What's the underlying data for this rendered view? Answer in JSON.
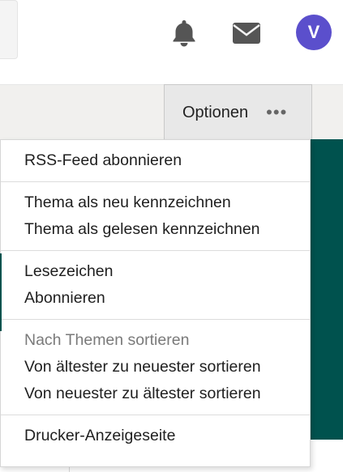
{
  "header": {
    "avatar_initial": "V",
    "bell_icon": "bell-icon",
    "mail_icon": "envelope-icon"
  },
  "toolbar": {
    "options_label": "Optionen",
    "more_icon": "•••"
  },
  "menu": {
    "sections": [
      {
        "items": [
          "RSS-Feed abonnieren"
        ]
      },
      {
        "items": [
          "Thema als neu kennzeichnen",
          "Thema als gelesen kennzeichnen"
        ]
      },
      {
        "items": [
          "Lesezeichen",
          "Abonnieren"
        ]
      },
      {
        "heading": "Nach Themen sortieren",
        "items": [
          "Von ältester zu neuester sortieren",
          "Von neuester zu ältester sortieren"
        ]
      },
      {
        "items": [
          "Drucker-Anzeigeseite"
        ]
      }
    ]
  },
  "colors": {
    "accent": "#00524e",
    "avatar": "#5b4fcc"
  }
}
